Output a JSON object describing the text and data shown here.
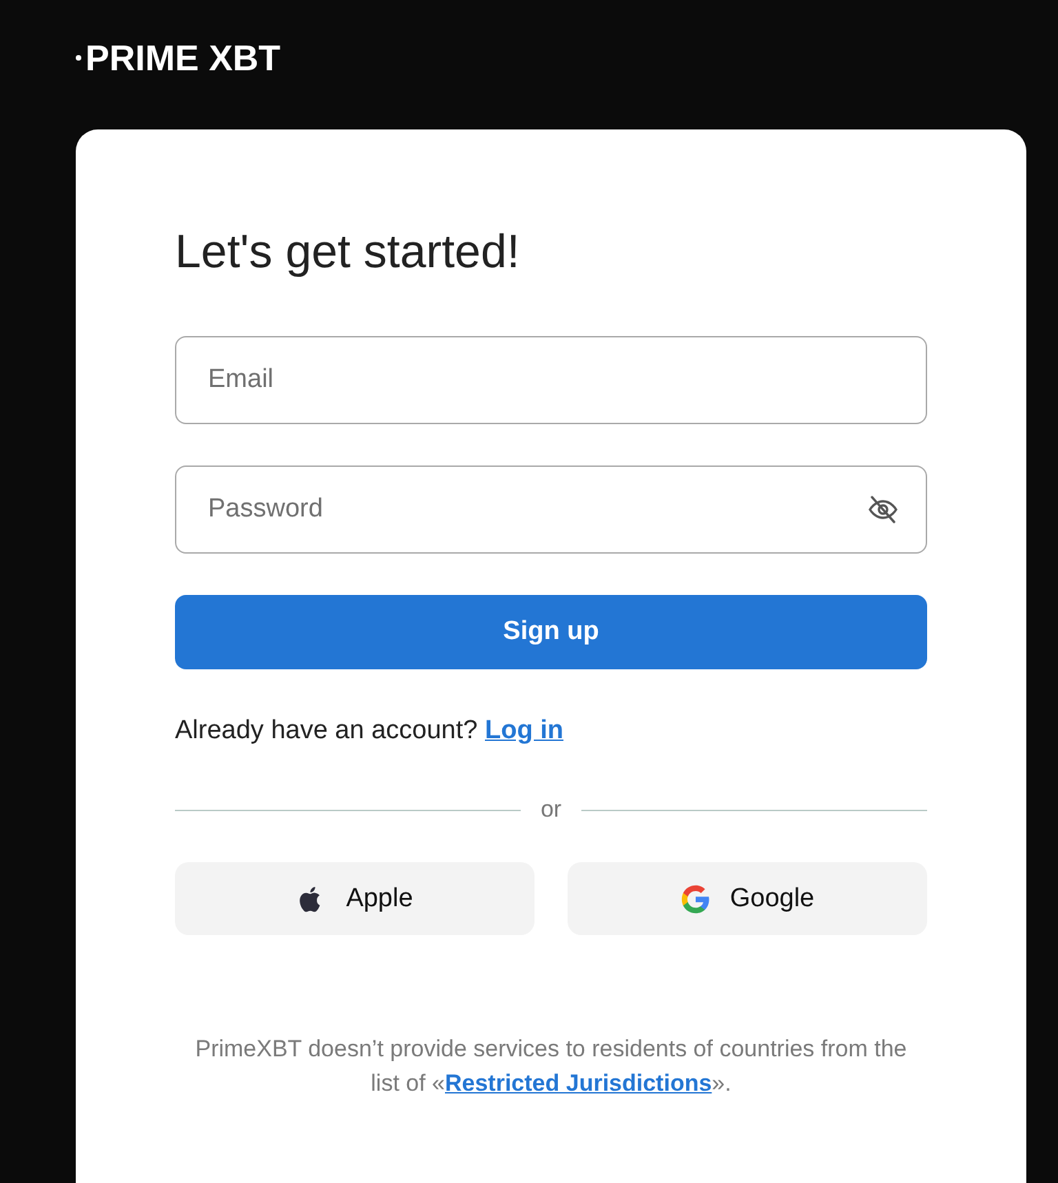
{
  "header": {
    "logo": "PRIME XBT"
  },
  "form": {
    "title": "Let's get started!",
    "email": {
      "placeholder": "Email"
    },
    "password": {
      "placeholder": "Password",
      "visible": false
    },
    "submit": "Sign up",
    "login_prompt": {
      "text": "Already have an account?",
      "link": "Log in"
    },
    "divider": "or",
    "social": [
      {
        "kind": "apple",
        "label": "Apple"
      },
      {
        "kind": "google",
        "label": "Google"
      }
    ],
    "disclaimer": {
      "text_before": "PrimeXBT doesn’t provide services to residents of countries from the list of «",
      "link": "Restricted Jurisdictions",
      "text_after": "»."
    }
  }
}
